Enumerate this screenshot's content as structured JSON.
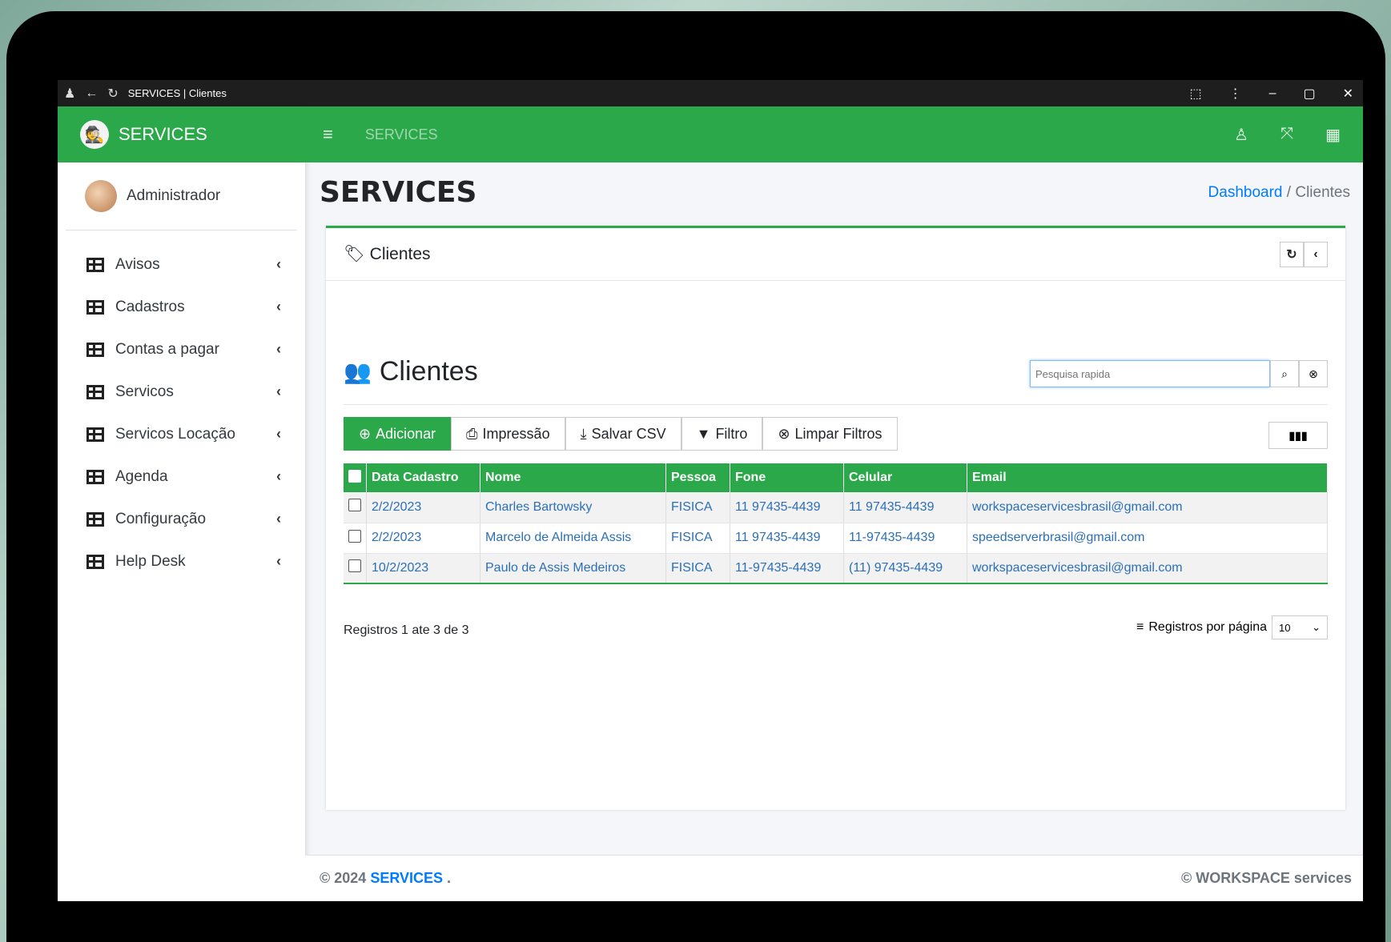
{
  "window": {
    "title": "SERVICES | Clientes"
  },
  "sidebar": {
    "brand": "SERVICES",
    "user": "Administrador",
    "items": [
      {
        "label": "Avisos"
      },
      {
        "label": "Cadastros"
      },
      {
        "label": "Contas a pagar"
      },
      {
        "label": "Servicos"
      },
      {
        "label": "Servicos Locação"
      },
      {
        "label": "Agenda"
      },
      {
        "label": "Configuração"
      },
      {
        "label": "Help Desk"
      }
    ]
  },
  "topnav": {
    "title": "SERVICES"
  },
  "content": {
    "title": "SERVICES",
    "breadcrumb": {
      "home": "Dashboard",
      "separator": "/",
      "current": "Clientes"
    }
  },
  "card": {
    "header": "Clientes",
    "table_title": "Clientes",
    "search_placeholder": "Pesquisa rapida",
    "buttons": {
      "add": "Adicionar",
      "print": "Impressão",
      "csv": "Salvar CSV",
      "filter": "Filtro",
      "clear": "Limpar Filtros"
    },
    "columns": [
      "Data Cadastro",
      "Nome",
      "Pessoa",
      "Fone",
      "Celular",
      "Email"
    ],
    "rows": [
      [
        "2/2/2023",
        "Charles Bartowsky",
        "FISICA",
        "11 97435-4439",
        "11 97435-4439",
        "workspaceservicesbrasil@gmail.com"
      ],
      [
        "2/2/2023",
        "Marcelo de Almeida Assis",
        "FISICA",
        "11 97435-4439",
        "11-97435-4439",
        "speedserverbrasil@gmail.com"
      ],
      [
        "10/2/2023",
        "Paulo de Assis Medeiros",
        "FISICA",
        "11-97435-4439",
        "(11) 97435-4439",
        "workspaceservicesbrasil@gmail.com"
      ]
    ],
    "records_info": "Registros 1 ate 3 de 3",
    "per_page_label": "Registros por página",
    "per_page_value": "10"
  },
  "footer": {
    "left_prefix": "© 2024",
    "left_brand": "SERVICES",
    "left_suffix": ".",
    "right": "© WORKSPACE services"
  },
  "colors": {
    "primary": "#2ba84a",
    "link": "#007bff"
  }
}
